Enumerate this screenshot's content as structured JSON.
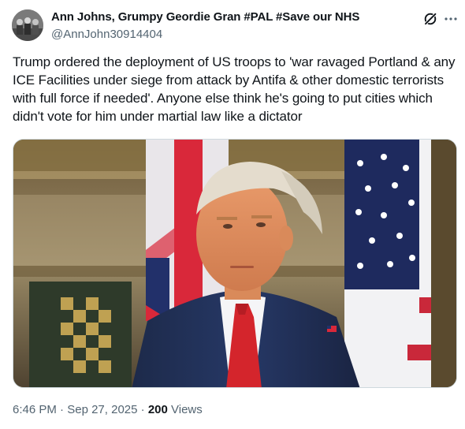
{
  "author": {
    "display_name": "Ann Johns, Grumpy Geordie Gran #PAL #Save our NHS",
    "handle": "@AnnJohn30914404"
  },
  "post": {
    "text": "Trump ordered the deployment of US troops to 'war ravaged Portland & any ICE Facilities under siege from attack by Antifa & other domestic terrorists with full force if needed'. Anyone else think he's going to put cities which didn't vote for him under martial law like a dictator"
  },
  "meta": {
    "time": "6:46 PM",
    "separator": "·",
    "date": "Sep 27, 2025",
    "views_count": "200",
    "views_label": "Views"
  },
  "icons": {
    "header_left": "grok-icon",
    "header_right": "more-icon"
  },
  "colors": {
    "text_primary": "#0f1419",
    "text_secondary": "#536471",
    "border": "#cfd9de"
  }
}
